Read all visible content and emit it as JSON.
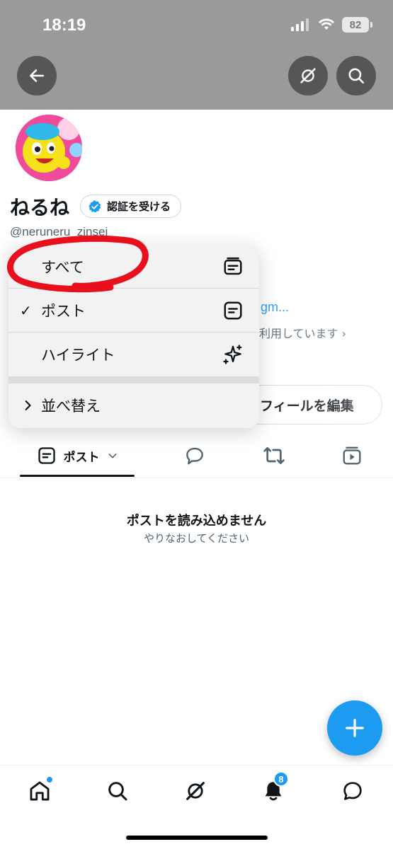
{
  "status_bar": {
    "time": "18:19",
    "battery": "82"
  },
  "profile": {
    "name": "ねるね",
    "verify_label": "認証を受ける",
    "handle": "@neruneru_zinsei",
    "link_fragment": "gm...",
    "premium_fragment": "利用しています",
    "edit_profile_label": "フィールを編集"
  },
  "menu": {
    "items": [
      {
        "label": "すべて",
        "checked": false,
        "icon": "timeline-all-icon"
      },
      {
        "label": "ポスト",
        "checked": true,
        "icon": "post-icon"
      },
      {
        "label": "ハイライト",
        "checked": false,
        "icon": "sparkle-icon"
      }
    ],
    "sort_label": "並べ替え",
    "check_mark": "✓",
    "annotation_color": "#e8101c"
  },
  "tabs": {
    "posts_label": "ポスト"
  },
  "empty_state": {
    "title": "ポストを読み込めません",
    "subtitle": "やりなおしてください"
  },
  "notifications": {
    "badge_count": "8"
  },
  "colors": {
    "accent": "#1d9bf0",
    "header_gray": "#9a9a9a",
    "text": "#0f1419",
    "muted": "#536471"
  }
}
